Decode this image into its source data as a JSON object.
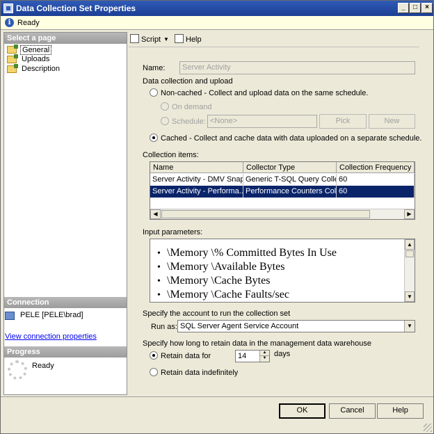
{
  "window": {
    "title": "Data Collection Set Properties"
  },
  "status": {
    "text": "Ready"
  },
  "left_pane": {
    "select_page_header": "Select a page",
    "pages": [
      {
        "label": "General",
        "selected": true
      },
      {
        "label": "Uploads",
        "selected": false
      },
      {
        "label": "Description",
        "selected": false
      }
    ],
    "connection_header": "Connection",
    "connection_server": "PELE [PELE\\brad]",
    "connection_link": "View connection properties",
    "progress_header": "Progress",
    "progress_status": "Ready"
  },
  "toolbar": {
    "script_label": "Script",
    "help_label": "Help"
  },
  "form": {
    "name_label": "Name:",
    "name_value": "Server Activity",
    "data_collection_label": "Data collection and upload",
    "noncached_label": "Non-cached - Collect and upload data on the same schedule.",
    "on_demand_label": "On demand",
    "schedule_label": "Schedule:",
    "schedule_value": "<None>",
    "pick_label": "Pick",
    "new_label": "New",
    "cached_label": "Cached - Collect and cache data with data uploaded on a separate schedule.",
    "collection_items_label": "Collection items:",
    "grid_headers": [
      "Name",
      "Collector Type",
      "Collection Frequency (sec"
    ],
    "grid_rows": [
      {
        "name": "Server Activity - DMV Snap...",
        "collector_type": "Generic T-SQL Query Colle...",
        "frequency": "60",
        "selected": false
      },
      {
        "name": "Server Activity - Performa...",
        "collector_type": "Performance Counters Coll...",
        "frequency": "60",
        "selected": true
      }
    ],
    "input_params_label": "Input parameters:",
    "input_params": [
      "\\Memory \\% Committed Bytes In Use",
      "\\Memory \\Available Bytes",
      "\\Memory \\Cache Bytes",
      "\\Memory \\Cache Faults/sec"
    ],
    "account_label": "Specify the account to run the collection set",
    "run_as_label": "Run as:",
    "run_as_value": "SQL Server Agent Service Account",
    "retain_header": "Specify how long to retain data in the management data warehouse",
    "retain_for_label": "Retain data for",
    "retain_days": "14",
    "days_label": "days",
    "retain_indef_label": "Retain data indefinitely"
  },
  "buttons": {
    "ok": "OK",
    "cancel": "Cancel",
    "help": "Help"
  }
}
